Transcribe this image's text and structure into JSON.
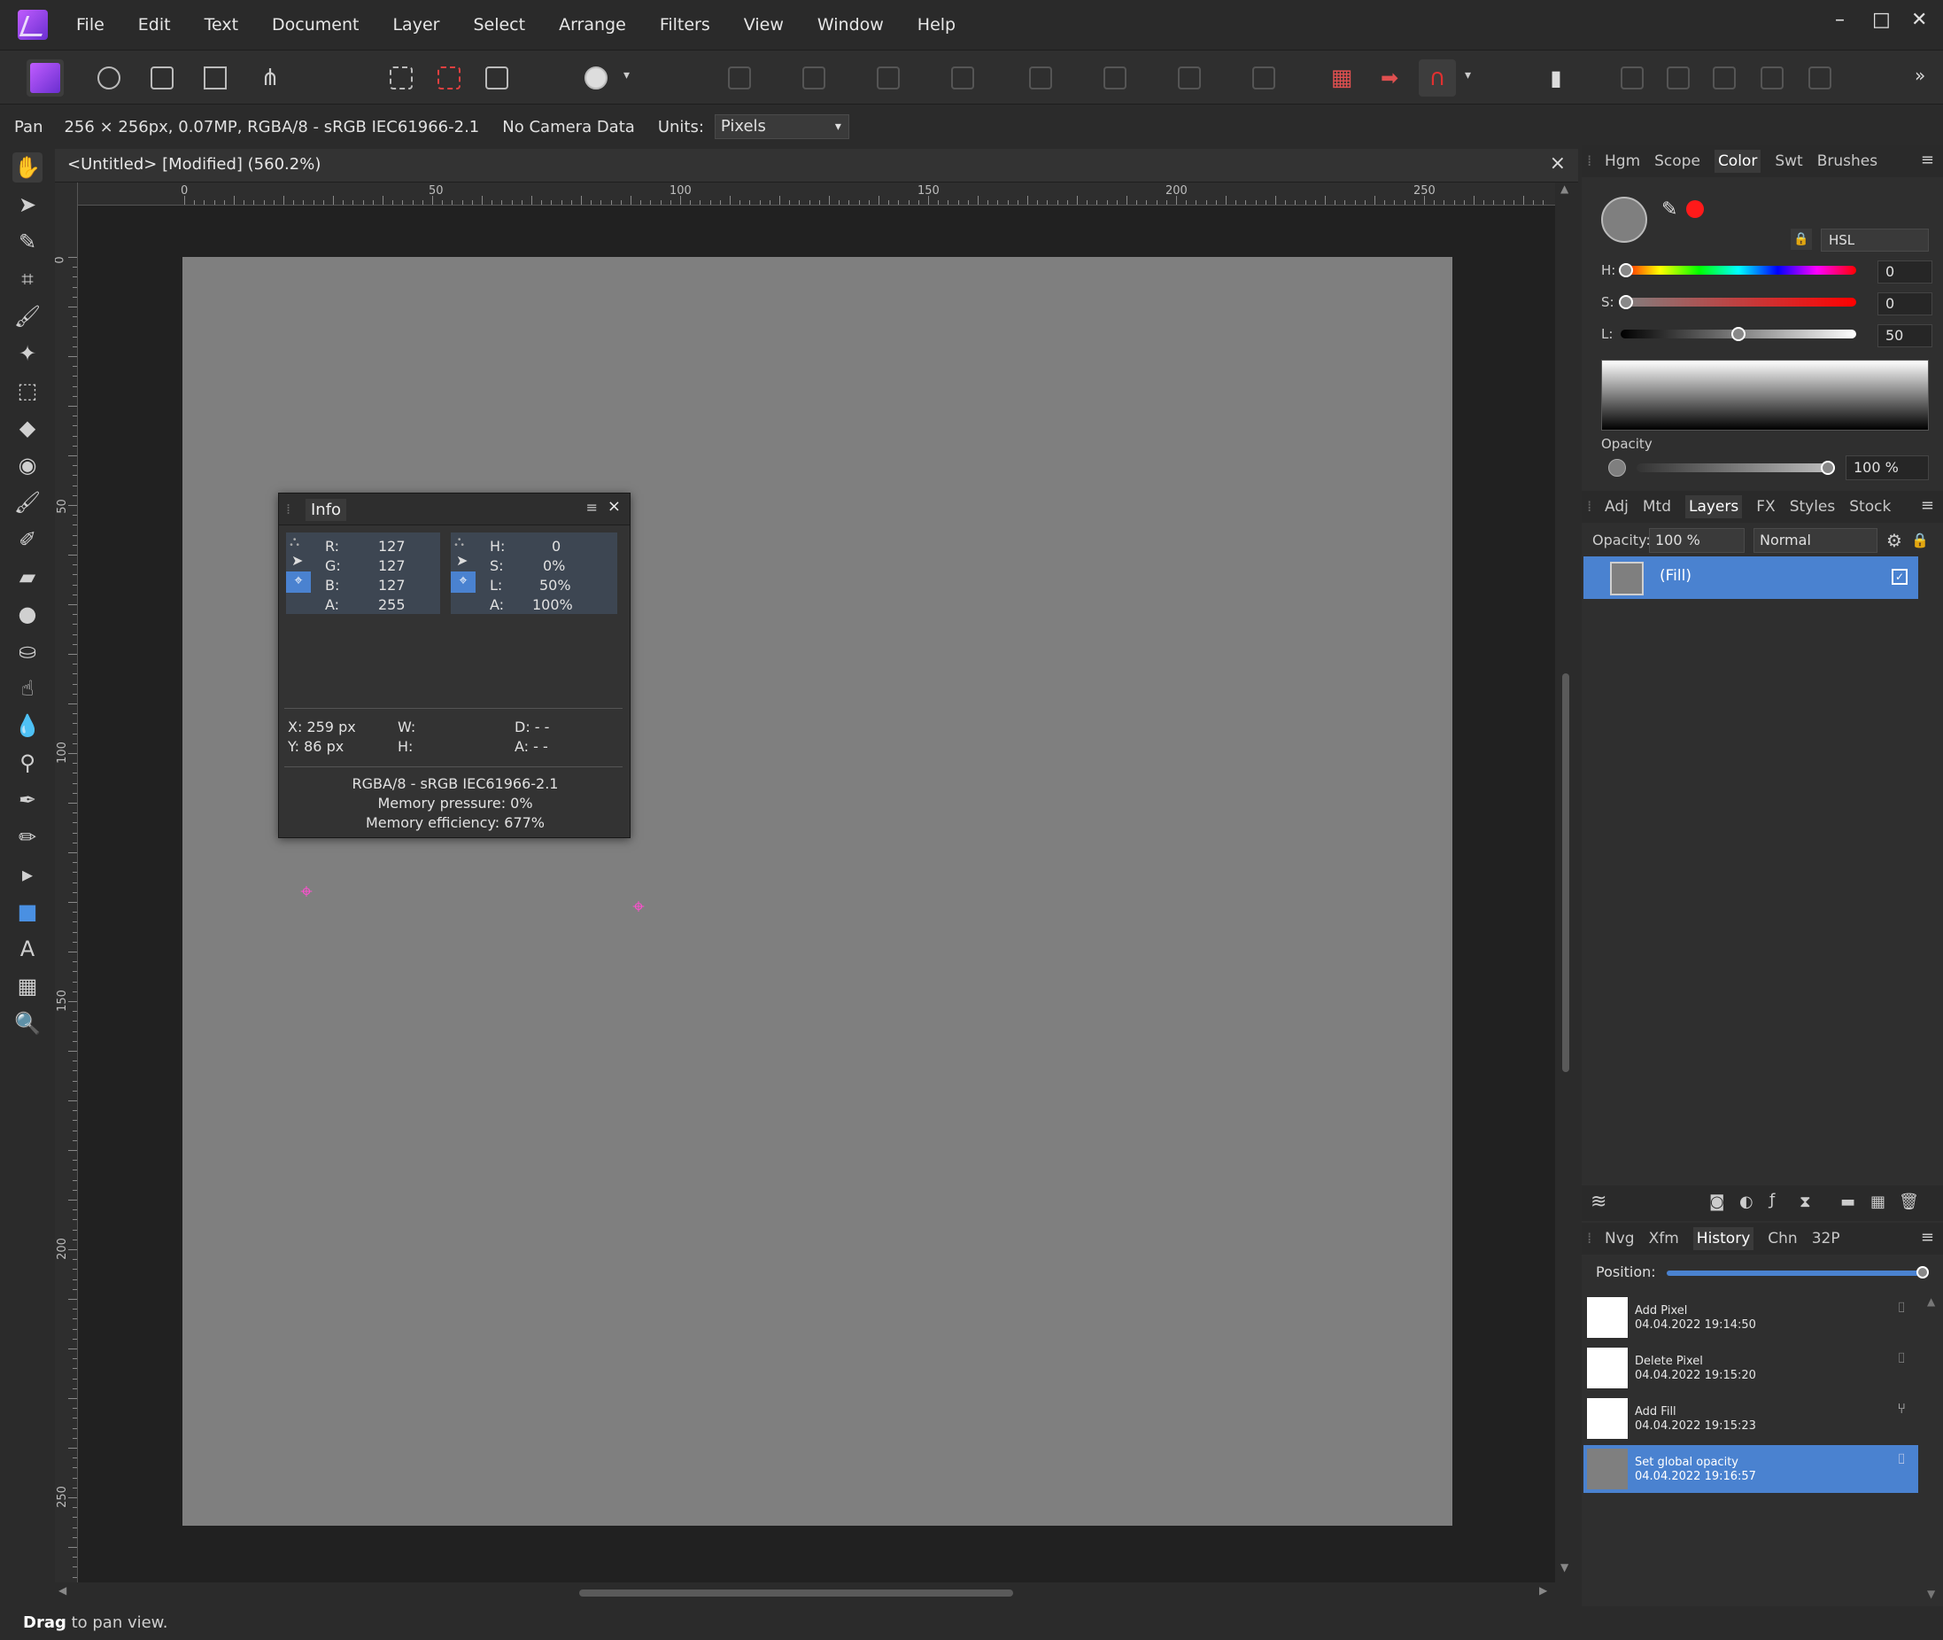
{
  "menubar": {
    "items": [
      "File",
      "Edit",
      "Text",
      "Document",
      "Layer",
      "Select",
      "Arrange",
      "Filters",
      "View",
      "Window",
      "Help"
    ],
    "window_controls": [
      "–",
      "□",
      "✕"
    ]
  },
  "context": {
    "tool_name": "Pan",
    "doc_info": "256 × 256px, 0.07MP, RGBA/8 - sRGB IEC61966-2.1",
    "camera": "No Camera Data",
    "units_label": "Units:",
    "units_value": "Pixels"
  },
  "document": {
    "title": "<Untitled> [Modified] (560.2%)",
    "ruler_unit": "px",
    "ruler_h": [
      "0",
      "50",
      "100",
      "150",
      "200",
      "250"
    ],
    "ruler_v": [
      "0",
      "50",
      "100",
      "150",
      "200",
      "250"
    ]
  },
  "info_panel": {
    "tab": "Info",
    "rgb": {
      "r_label": "R:",
      "r": "127",
      "g_label": "G:",
      "g": "127",
      "b_label": "B:",
      "b": "127",
      "a_label": "A:",
      "a": "255"
    },
    "hsl": {
      "h_label": "H:",
      "h": "0",
      "s_label": "S:",
      "s": "0%",
      "l_label": "L:",
      "l": "50%",
      "a_label": "A:",
      "a": "100%"
    },
    "x": "X: 259 px",
    "y": "Y: 86 px",
    "w": "W:",
    "h": "H:",
    "d": "D: - -",
    "angle": "A: - -",
    "profile": "RGBA/8 - sRGB IEC61966-2.1",
    "memory_pressure": "Memory pressure: 0%",
    "memory_efficiency": "Memory efficiency: 677%"
  },
  "color_panel": {
    "tabs": [
      "Hgm",
      "Scope",
      "Color",
      "Swt",
      "Brushes"
    ],
    "active_tab": "Color",
    "model": "HSL",
    "h_label": "H:",
    "h_value": "0",
    "s_label": "S:",
    "s_value": "0",
    "l_label": "L:",
    "l_value": "50",
    "opacity_label": "Opacity",
    "opacity_value": "100 %"
  },
  "layers_panel": {
    "tabs": [
      "Adj",
      "Mtd",
      "Layers",
      "FX",
      "Styles",
      "Stock"
    ],
    "active_tab": "Layers",
    "opacity_label": "Opacity:",
    "opacity_value": "100 %",
    "blend_mode": "Normal",
    "layers": [
      {
        "name": "(Fill)",
        "visible": true
      }
    ]
  },
  "history_panel": {
    "tabs": [
      "Nvg",
      "Xfm",
      "History",
      "Chn",
      "32P"
    ],
    "active_tab": "History",
    "position_label": "Position:",
    "items": [
      {
        "name": "Add Pixel",
        "time": "04.04.2022 19:14:50"
      },
      {
        "name": "Delete Pixel",
        "time": "04.04.2022 19:15:20"
      },
      {
        "name": "Add Fill",
        "time": "04.04.2022 19:15:23"
      },
      {
        "name": "Set global opacity",
        "time": "04.04.2022 19:16:57"
      }
    ]
  },
  "status": {
    "bold": "Drag",
    "rest": " to pan view."
  },
  "colors": {
    "accent": "#4a82d0",
    "canvas": "#7f7f7f",
    "marker": "#ff4fd0"
  }
}
